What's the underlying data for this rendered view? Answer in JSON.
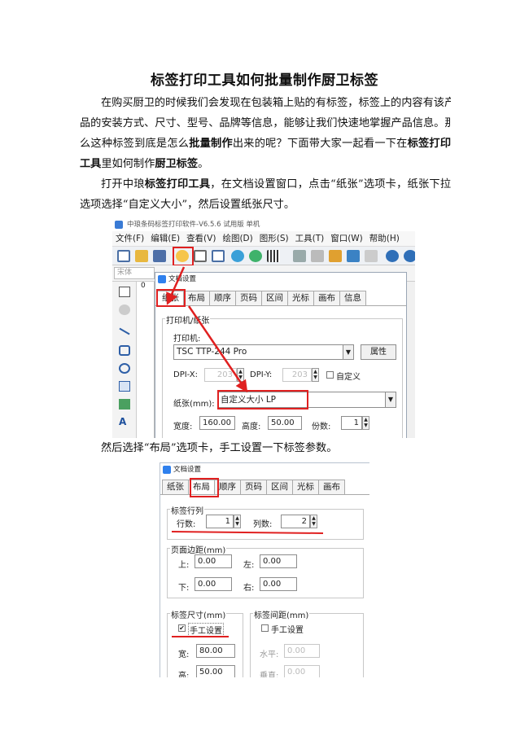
{
  "doc": {
    "title": "标签打印工具如何批量制作厨卫标签",
    "p1_l1": "在购买厨卫的时候我们会发现在包装箱上贴的有标签，标签上的内容有该产",
    "p1_l2": "品的安装方式、尺寸、型号、品牌等信息，能够让我们快速地掌握产品信息。那",
    "p1_l3a": "么这种标签到底是怎么",
    "p1_l3b": "批量制作",
    "p1_l3c": "出来的呢？下面带大家一起看一下在",
    "p1_l3d": "标签打印",
    "p1_l4a": "工具",
    "p1_l4b": "里如何制作",
    "p1_l4c": "厨卫标签",
    "p1_l4d": "。",
    "p2_l1a": "打开中琅",
    "p2_l1b": "标签打印工具",
    "p2_l1c": "，在文档设置窗口，点击“纸张”选项卡，纸张下拉",
    "p2_l2": "选项选择“自定义大小”，然后设置纸张尺寸。",
    "caption2": "然后选择“布局”选项卡，手工设置一下标签参数。"
  },
  "app": {
    "window_title": "中琅条码标签打印软件-V6.5.6 试用版 单机",
    "menus": [
      "文件(F)",
      "编辑(E)",
      "查看(V)",
      "绘图(D)",
      "图形(S)",
      "工具(T)",
      "窗口(W)",
      "帮助(H)"
    ],
    "font_name": "宋体",
    "ruler_num": "0"
  },
  "dialog1": {
    "title": "文档设置",
    "tabs": [
      "纸张",
      "布局",
      "顺序",
      "页码",
      "区间",
      "光标",
      "画布",
      "信息"
    ],
    "group_printer": "打印机/纸张",
    "printer_label": "打印机:",
    "printer_value": "TSC TTP-244 Pro",
    "properties_button": "属性",
    "dpix_label": "DPI-X:",
    "dpix_value": "203",
    "dpiy_label": "DPI-Y:",
    "dpiy_value": "203",
    "custom_label": "自定义",
    "paper_label": "纸张(mm):",
    "paper_value": "自定义大小 LP",
    "width_label": "宽度:",
    "width_value": "160.00",
    "height_label": "高度:",
    "height_value": "50.00",
    "copies_label": "份数:",
    "copies_value": "1"
  },
  "dialog2": {
    "title": "文档设置",
    "tabs": [
      "纸张",
      "布局",
      "顺序",
      "页码",
      "区间",
      "光标",
      "画布"
    ],
    "group_rowcol": "标签行列",
    "rows_label": "行数:",
    "rows_value": "1",
    "cols_label": "列数:",
    "cols_value": "2",
    "group_margin": "页面边距(mm)",
    "top_label": "上:",
    "top_value": "0.00",
    "left_label": "左:",
    "left_value": "0.00",
    "bottom_label": "下:",
    "bottom_value": "0.00",
    "right_label": "右:",
    "right_value": "0.00",
    "group_size": "标签尺寸(mm)",
    "size_manual": "手工设置",
    "size_w_label": "宽:",
    "size_w_value": "80.00",
    "size_h_label": "高:",
    "size_h_value": "50.00",
    "group_gap": "标签间距(mm)",
    "gap_manual": "手工设置",
    "gap_h_label": "水平:",
    "gap_h_value": "0.00",
    "gap_v_label": "垂直:",
    "gap_v_value": "0.00"
  },
  "colors": {
    "highlight": "#e02020",
    "app_accent": "#2f80ed"
  }
}
